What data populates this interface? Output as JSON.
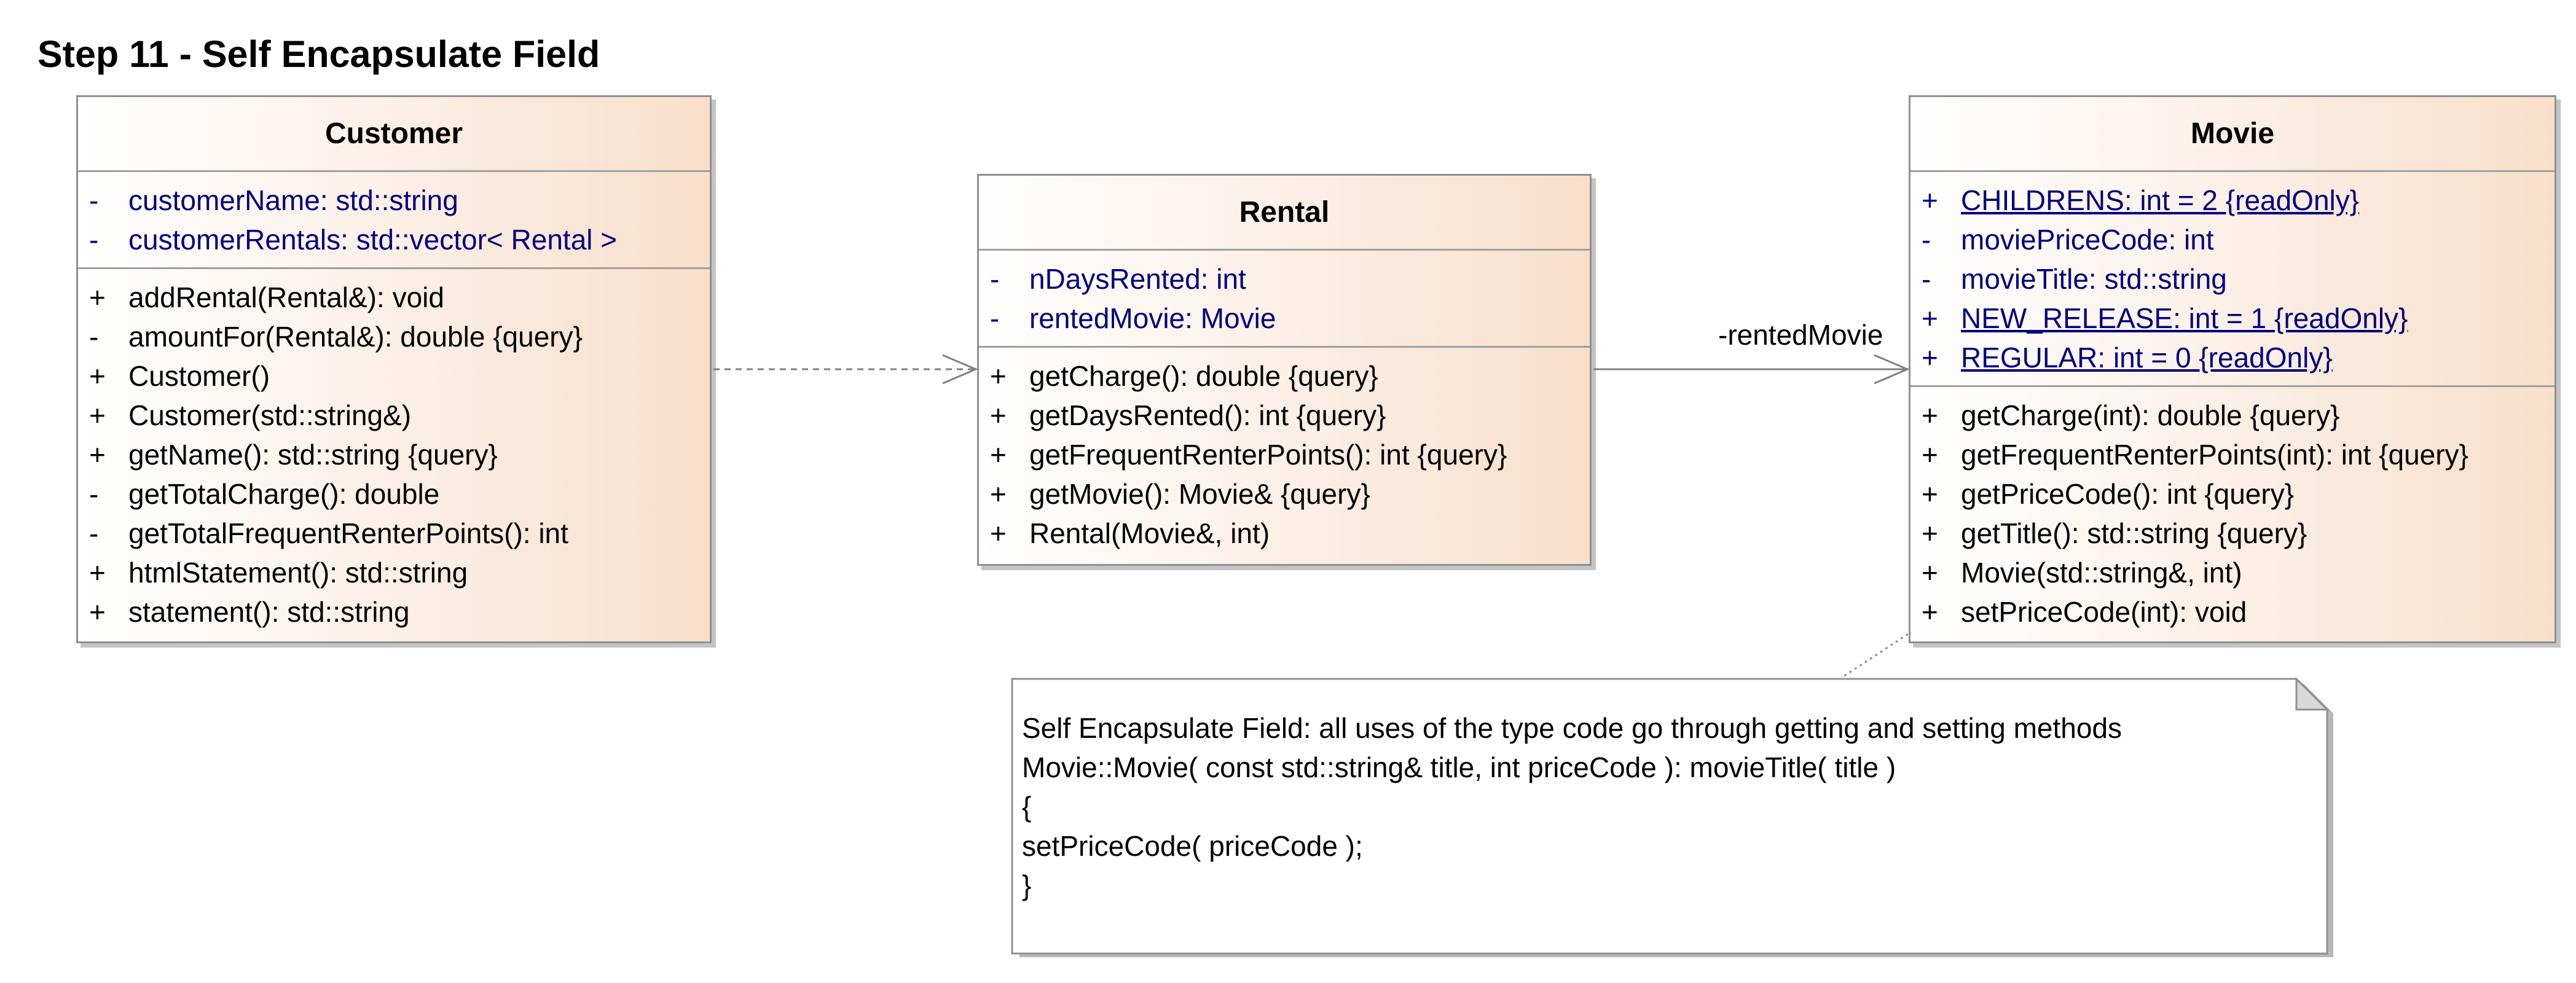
{
  "title": "Step 11 - Self Encapsulate Field",
  "classes": {
    "customer": {
      "name": "Customer",
      "attributes": [
        {
          "vis": "-",
          "text": "customerName: std::string"
        },
        {
          "vis": "-",
          "text": "customerRentals: std::vector< Rental >"
        }
      ],
      "operations": [
        {
          "vis": "+",
          "text": "addRental(Rental&): void"
        },
        {
          "vis": "-",
          "text": "amountFor(Rental&): double {query}"
        },
        {
          "vis": "+",
          "text": "Customer()"
        },
        {
          "vis": "+",
          "text": "Customer(std::string&)"
        },
        {
          "vis": "+",
          "text": "getName(): std::string {query}"
        },
        {
          "vis": "-",
          "text": "getTotalCharge(): double"
        },
        {
          "vis": "-",
          "text": "getTotalFrequentRenterPoints(): int"
        },
        {
          "vis": "+",
          "text": "htmlStatement(): std::string"
        },
        {
          "vis": "+",
          "text": "statement(): std::string"
        }
      ]
    },
    "rental": {
      "name": "Rental",
      "attributes": [
        {
          "vis": "-",
          "text": "nDaysRented: int"
        },
        {
          "vis": "-",
          "text": "rentedMovie: Movie"
        }
      ],
      "operations": [
        {
          "vis": "+",
          "text": "getCharge(): double {query}"
        },
        {
          "vis": "+",
          "text": "getDaysRented(): int {query}"
        },
        {
          "vis": "+",
          "text": "getFrequentRenterPoints(): int {query}"
        },
        {
          "vis": "+",
          "text": "getMovie(): Movie& {query}"
        },
        {
          "vis": "+",
          "text": "Rental(Movie&, int)"
        }
      ]
    },
    "movie": {
      "name": "Movie",
      "attributes": [
        {
          "vis": "+",
          "text": "CHILDRENS: int = 2 {readOnly}"
        },
        {
          "vis": "-",
          "text": "moviePriceCode: int"
        },
        {
          "vis": "-",
          "text": "movieTitle: std::string"
        },
        {
          "vis": "+",
          "text": "NEW_RELEASE: int = 1 {readOnly}"
        },
        {
          "vis": "+",
          "text": "REGULAR: int = 0 {readOnly}"
        }
      ],
      "operations": [
        {
          "vis": "+",
          "text": "getCharge(int): double {query}"
        },
        {
          "vis": "+",
          "text": "getFrequentRenterPoints(int): int {query}"
        },
        {
          "vis": "+",
          "text": "getPriceCode(): int {query}"
        },
        {
          "vis": "+",
          "text": "getTitle(): std::string {query}"
        },
        {
          "vis": "+",
          "text": "Movie(std::string&, int)"
        },
        {
          "vis": "+",
          "text": "setPriceCode(int): void"
        }
      ]
    }
  },
  "association": {
    "label": "-rentedMovie"
  },
  "note": {
    "lines": [
      "Self Encapsulate Field: all uses of the type code go through getting and setting methods",
      "Movie::Movie( const std::string& title, int priceCode ): movieTitle( title )",
      "{",
      "setPriceCode( priceCode );",
      "}"
    ]
  },
  "colors": {
    "attribute_text": "#000080",
    "operation_text": "#000000",
    "class_fill_light": "#ffffff",
    "class_fill_dark": "#f8dfca",
    "border": "#909090",
    "connector": "#808080"
  }
}
